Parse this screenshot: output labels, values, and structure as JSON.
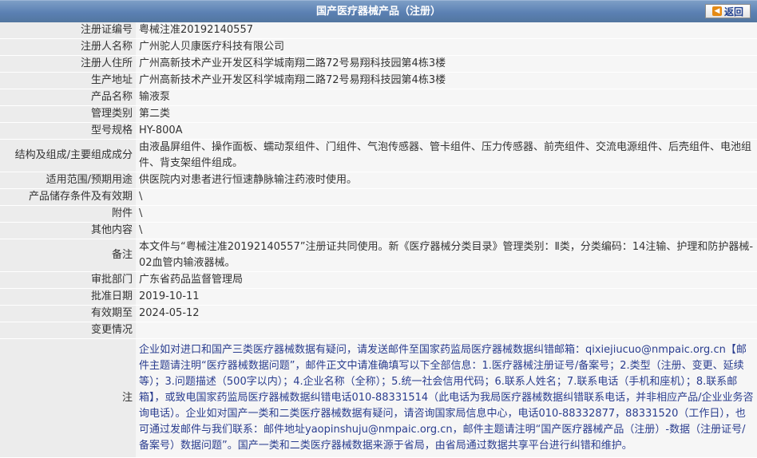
{
  "header": {
    "title": "国产医疗器械产品（注册）",
    "back_label": "返回"
  },
  "rows": [
    {
      "label": "注册证编号",
      "value": "粤械注准20192140557"
    },
    {
      "label": "注册人名称",
      "value": "广州驼人贝康医疗科技有限公司"
    },
    {
      "label": "注册人住所",
      "value": "广州高新技术产业开发区科学城南翔二路72号易翔科技园第4栋3楼"
    },
    {
      "label": "生产地址",
      "value": "广州高新技术产业开发区科学城南翔二路72号易翔科技园第4栋3楼"
    },
    {
      "label": "产品名称",
      "value": "输液泵"
    },
    {
      "label": "管理类别",
      "value": "第二类"
    },
    {
      "label": "型号规格",
      "value": "HY-800A"
    },
    {
      "label": "结构及组成/主要组成成分",
      "value": "由液晶屏组件、操作面板、蠕动泵组件、门组件、气泡传感器、管卡组件、压力传感器、前壳组件、交流电源组件、后壳组件、电池组件、背支架组件组成。"
    },
    {
      "label": "适用范围/预期用途",
      "value": "供医院内对患者进行恒速静脉输注药液时使用。"
    },
    {
      "label": "产品储存条件及有效期",
      "value": "\\"
    },
    {
      "label": "附件",
      "value": "\\"
    },
    {
      "label": "其他内容",
      "value": "\\"
    },
    {
      "label": "备注",
      "value": "本文件与“粤械注准20192140557”注册证共同使用。新《医疗器械分类目录》管理类别：Ⅱ类，分类编码：14注输、护理和防护器械-02血管内输液器械。"
    },
    {
      "label": "审批部门",
      "value": "广东省药品监督管理局"
    },
    {
      "label": "批准日期",
      "value": "2019-10-11"
    },
    {
      "label": "有效期至",
      "value": "2024-05-12"
    },
    {
      "label": "变更情况",
      "value": ""
    }
  ],
  "note": {
    "label": "注",
    "text": "企业如对进口和国产三类医疗器械数据有疑问，请发送邮件至国家药监局医疗器械数据纠错邮箱：qixiejiucuo@nmpaic.org.cn【邮件主题请注明“医疗器械数据问题”，邮件正文中请准确填写以下全部信息：1.医疗器械注册证号/备案号；2.类型（注册、变更、延续等）；3.问题描述（500字以内）；4.企业名称（全称）；5.统一社会信用代码；6.联系人姓名；7.联系电话（手机和座机）；8.联系邮箱】，或致电国家药监局医疗器械数据纠错电话010-88331514（此电话为我局医疗器械数据纠错联系电话，并非相应产品/企业业务咨询电话）。企业如对国产一类和二类医疗器械数据有疑问，请咨询国家局信息中心，电话010-88332877，88331520（工作日），也可通过发邮件与我们联系：邮件地址yaopinshuju@nmpaic.org.cn，邮件主题请注明“国产医疗器械产品（注册）-数据（注册证号/备案号）数据问题”。国产一类和二类医疗器械数据来源于省局，由省局通过数据共享平台进行纠错和维护。"
  }
}
